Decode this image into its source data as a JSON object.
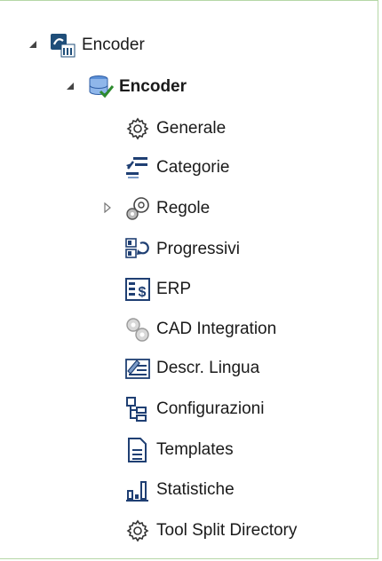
{
  "tree": {
    "root": {
      "label": "Encoder",
      "icon": "encoder-app-icon",
      "expanded": true
    },
    "child": {
      "label": "Encoder",
      "icon": "database-check-icon",
      "expanded": true
    },
    "items": [
      {
        "label": "Generale",
        "icon": "gear-icon"
      },
      {
        "label": "Categorie",
        "icon": "categories-icon"
      },
      {
        "label": "Regole",
        "icon": "gears-icon",
        "collapsed": true
      },
      {
        "label": "Progressivi",
        "icon": "progressive-icon"
      },
      {
        "label": "ERP",
        "icon": "erp-dollar-icon"
      },
      {
        "label": "CAD Integration",
        "icon": "cad-gears-icon"
      },
      {
        "label": "Descr. Lingua",
        "icon": "language-description-icon"
      },
      {
        "label": "Configurazioni",
        "icon": "configuration-icon"
      },
      {
        "label": "Templates",
        "icon": "template-document-icon"
      },
      {
        "label": "Statistiche",
        "icon": "statistics-icon"
      },
      {
        "label": "Tool Split Directory",
        "icon": "gear-icon"
      }
    ]
  }
}
